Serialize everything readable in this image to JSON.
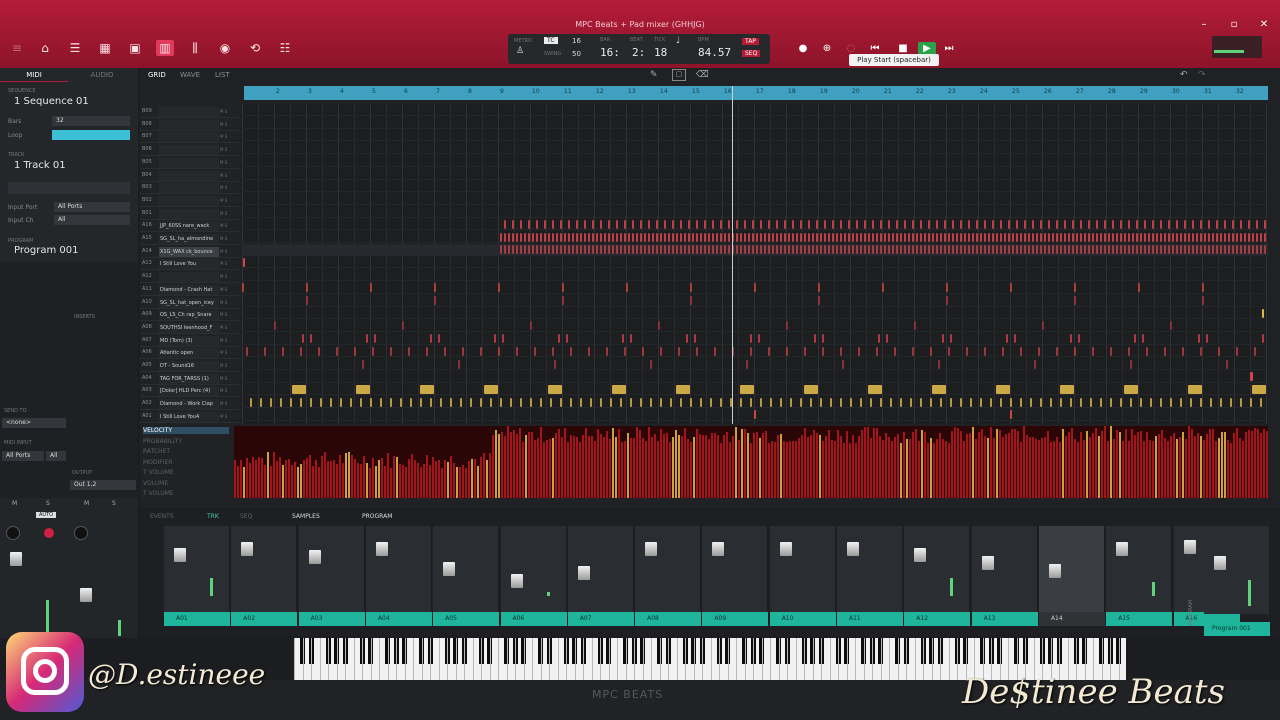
{
  "window_title": "MPC Beats + Pad mixer (GHHJG)",
  "tooltip": "Play Start (spacebar)",
  "transport": {
    "tc_label": "TC",
    "tc_value": "16",
    "swing_label": "SWING",
    "swing_value": "50",
    "bar": "16:",
    "beat": "2:",
    "tick": "18",
    "bpm": "84.57",
    "tap": "TAP",
    "seq": "SEQ",
    "metro_label": "METRO",
    "bar_label": "BAR",
    "beat_label": "BEAT",
    "tick_label": "TICK",
    "bpm_label": "BPM"
  },
  "left": {
    "midi_tab": "MIDI",
    "audio_tab": "AUDIO",
    "sequence_hdr": "SEQUENCE",
    "sequence": "1 Sequence 01",
    "bars_label": "Bars",
    "bars_value": "32",
    "loop_label": "Loop",
    "track_hdr": "TRACK",
    "track": "1 Track 01",
    "input_port_label": "Input Port",
    "input_port": "All Ports",
    "input_ch_label": "Input Ch",
    "input_ch": "All",
    "program_hdr": "PROGRAM",
    "program": "Program 001",
    "inserts": "INSERTS",
    "send_to": "SEND TO",
    "send_value": "<none>",
    "midi_input": "MIDI INPUT",
    "midi_input_port": "All Ports",
    "midi_input_ch": "All",
    "output_label": "OUTPUT",
    "output_value": "Out 1,2",
    "auto": "AUTO",
    "m": "M",
    "s": "S"
  },
  "grid_tabs": [
    "GRID",
    "WAVE",
    "LIST"
  ],
  "ruler": [
    "2",
    "3",
    "4",
    "5",
    "6",
    "7",
    "8",
    "9",
    "10",
    "11",
    "12",
    "13",
    "14",
    "15",
    "16",
    "17",
    "18",
    "19",
    "20",
    "21",
    "22",
    "23",
    "24",
    "25",
    "26",
    "27",
    "28",
    "29",
    "30",
    "31",
    "32"
  ],
  "tracks": [
    {
      "id": "B09",
      "name": ""
    },
    {
      "id": "B08",
      "name": ""
    },
    {
      "id": "B07",
      "name": ""
    },
    {
      "id": "B06",
      "name": ""
    },
    {
      "id": "B05",
      "name": ""
    },
    {
      "id": "B04",
      "name": ""
    },
    {
      "id": "B03",
      "name": ""
    },
    {
      "id": "B02",
      "name": ""
    },
    {
      "id": "B01",
      "name": ""
    },
    {
      "id": "A16",
      "name": "JJP_60SS nare_wack"
    },
    {
      "id": "A15",
      "name": "SG_SL_ha_almondine"
    },
    {
      "id": "A14",
      "name": "X1G_WAX ck_bounce"
    },
    {
      "id": "A13",
      "name": "I Still Love You"
    },
    {
      "id": "A12",
      "name": ""
    },
    {
      "id": "A11",
      "name": "Diamond - Crash Hat"
    },
    {
      "id": "A10",
      "name": "SG_SL_hat_open_icey"
    },
    {
      "id": "A09",
      "name": "OS_LS_Ch rap_Snare"
    },
    {
      "id": "A08",
      "name": "SOUTHSI leenhood_F"
    },
    {
      "id": "A07",
      "name": "MD (Tom) (3)"
    },
    {
      "id": "A06",
      "name": "Atlantic open"
    },
    {
      "id": "A05",
      "name": "DT - Sound16"
    },
    {
      "id": "A04",
      "name": "TAG FOR_TARSS (1)"
    },
    {
      "id": "A03",
      "name": "[Dolor] HLD Perc (4)"
    },
    {
      "id": "A02",
      "name": "Diamond - Work Clap"
    },
    {
      "id": "A01",
      "name": "I Still Love You4"
    }
  ],
  "lanes_menu": [
    "VELOCITY",
    "PROBABILITY",
    "RATCHET",
    "MODIFIER",
    "T VOLUME",
    "VOLUME",
    "T VOLUME"
  ],
  "mixer_tabs": {
    "events": "EVENTS",
    "trk": "TRK",
    "seq": "SEQ",
    "samples": "SAMPLES",
    "program": "PROGRAM"
  },
  "strips": [
    "A01",
    "A02",
    "A03",
    "A04",
    "A05",
    "A06",
    "A07",
    "A08",
    "A09",
    "A10",
    "A11",
    "A12",
    "A13",
    "A14",
    "A15",
    "A16"
  ],
  "program_strip": "Program 001",
  "program_vert": "PROGRAM",
  "footer_logo": "MPC BEATS",
  "watermark_handle": "@D.estineee",
  "watermark_brand": "De$tinee Beats",
  "colors": {
    "accent": "#b41c38",
    "teal": "#1fb59d",
    "ruler": "#3fa1bf",
    "note_red": "#d2434a",
    "note_yellow": "#e0b84a"
  }
}
